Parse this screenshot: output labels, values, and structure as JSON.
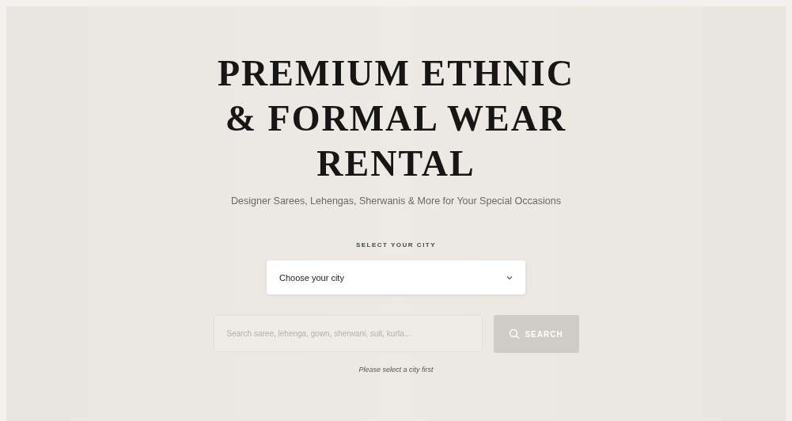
{
  "hero": {
    "title": "PREMIUM ETHNIC & FORMAL WEAR RENTAL",
    "subtitle": "Designer Sarees, Lehengas, Sherwanis & More for Your Special Occasions"
  },
  "city_select": {
    "label": "SELECT YOUR CITY",
    "value": "Choose your city"
  },
  "search": {
    "placeholder": "Search saree, lehenga, gown, sherwani, suit, kurta...",
    "disabled": true,
    "button": {
      "label": "SEARCH",
      "disabled": true
    }
  },
  "hint": "Please select a city first"
}
